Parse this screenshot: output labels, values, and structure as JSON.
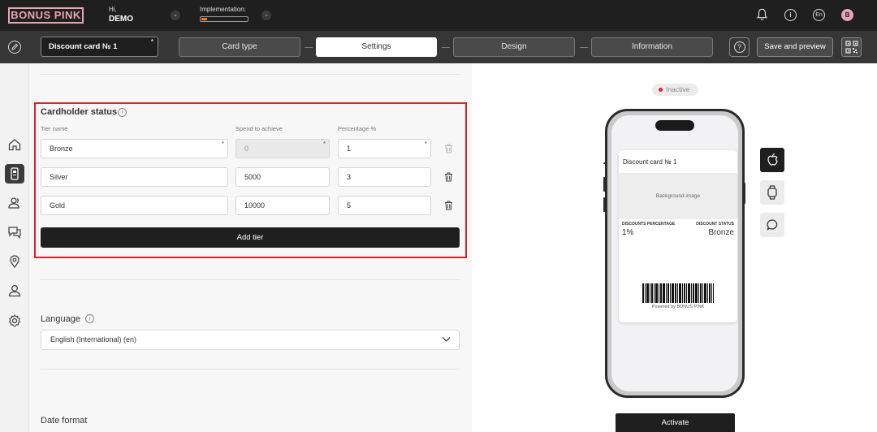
{
  "brand": {
    "logo_text": "BONUS PINK",
    "accent": "#e8a5b3"
  },
  "user": {
    "greeting": "Hi,",
    "name": "DEMO"
  },
  "implementation": {
    "label": "Implementation:",
    "progress": 0.12,
    "color": "#ff7a1a"
  },
  "topbar": {
    "language": "En",
    "avatar_letter": "B",
    "info_glyph": "i"
  },
  "toolbar": {
    "card_name": "Discount card № 1",
    "required_mark": "*",
    "steps": [
      {
        "label": "Card type",
        "active": false
      },
      {
        "label": "Settings",
        "active": true
      },
      {
        "label": "Design",
        "active": false
      },
      {
        "label": "Information",
        "active": false
      }
    ],
    "help_glyph": "?",
    "save_label": "Save and preview"
  },
  "sidebar": {
    "items": [
      {
        "icon": "home-icon",
        "active": false
      },
      {
        "icon": "phone-card-icon",
        "active": true
      },
      {
        "icon": "users-icon",
        "active": false
      },
      {
        "icon": "chat-icon",
        "active": false
      },
      {
        "icon": "location-pin-icon",
        "active": false
      },
      {
        "icon": "user-icon",
        "active": false
      },
      {
        "icon": "gear-icon",
        "active": false
      }
    ]
  },
  "cardholder_status": {
    "title": "Cardholder status",
    "columns": {
      "tier": "Tier name",
      "spend": "Spend to achieve",
      "percent": "Percentage %"
    },
    "tiers": [
      {
        "name": "Bronze",
        "spend": "0",
        "percent": "1",
        "spend_disabled": true
      },
      {
        "name": "Silver",
        "spend": "5000",
        "percent": "3",
        "spend_disabled": false
      },
      {
        "name": "Gold",
        "spend": "10000",
        "percent": "5",
        "spend_disabled": false
      }
    ],
    "add_label": "Add tier",
    "highlight_color": "#d8232a"
  },
  "language": {
    "title": "Language",
    "value": "English (International) (en)"
  },
  "date_format": {
    "title": "Date format"
  },
  "preview": {
    "status": "Inactive",
    "status_color": "#e0203a",
    "pass": {
      "title": "Discount card № 1",
      "background": "Background image",
      "left_label": "DISCOUNTS PERCENTAGE",
      "left_value": "1%",
      "right_label": "DISCOUNT STATUS",
      "right_value": "Bronze",
      "powered": "Powered by BONUS PINK"
    },
    "platforms": [
      {
        "icon": "apple-icon",
        "active": true
      },
      {
        "icon": "watch-icon",
        "active": false
      },
      {
        "icon": "message-icon",
        "active": false
      }
    ],
    "activate_label": "Activate"
  }
}
